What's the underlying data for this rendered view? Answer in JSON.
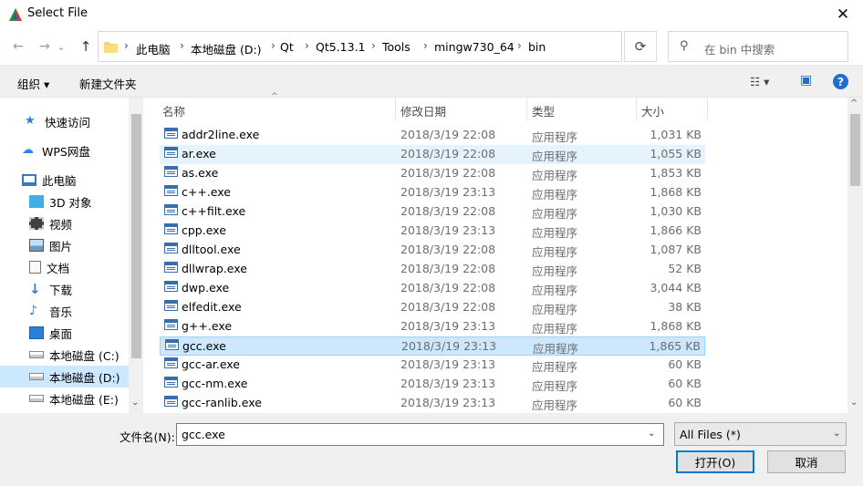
{
  "window": {
    "title": "Select File",
    "close": "✕"
  },
  "nav": {
    "back": "←",
    "forward": "→",
    "dropdown": "⌄",
    "up": "↑",
    "breadcrumb": [
      "此电脑",
      "本地磁盘 (D:)",
      "Qt",
      "Qt5.13.1",
      "Tools",
      "mingw730_64",
      "bin"
    ],
    "separator": "›",
    "refresh": "⟳",
    "search_placeholder": "在 bin 中搜索"
  },
  "toolbar": {
    "organize": "组织 ▾",
    "new_folder": "新建文件夹",
    "view_icon": "☷ ▾",
    "preview_icon": "▣",
    "help": "?"
  },
  "sidebar": {
    "items": [
      {
        "label": "快速访问",
        "icon": "star-icon"
      },
      {
        "label": "WPS网盘",
        "icon": "cloud-icon"
      },
      {
        "label": "此电脑",
        "icon": "computer-icon"
      },
      {
        "label": "3D 对象",
        "icon": "cube-icon"
      },
      {
        "label": "视频",
        "icon": "video-icon"
      },
      {
        "label": "图片",
        "icon": "picture-icon"
      },
      {
        "label": "文档",
        "icon": "document-icon"
      },
      {
        "label": "下载",
        "icon": "download-icon"
      },
      {
        "label": "音乐",
        "icon": "music-icon"
      },
      {
        "label": "桌面",
        "icon": "desktop-icon"
      },
      {
        "label": "本地磁盘 (C:)",
        "icon": "drive-icon"
      },
      {
        "label": "本地磁盘 (D:)",
        "icon": "drive-icon"
      },
      {
        "label": "本地磁盘 (E:)",
        "icon": "drive-icon"
      }
    ],
    "selected": "本地磁盘 (D:)"
  },
  "columns": {
    "name": "名称",
    "date": "修改日期",
    "type": "类型",
    "size": "大小"
  },
  "files": [
    {
      "name": "addr2line.exe",
      "date": "2018/3/19 22:08",
      "type": "应用程序",
      "size": "1,031 KB"
    },
    {
      "name": "ar.exe",
      "date": "2018/3/19 22:08",
      "type": "应用程序",
      "size": "1,055 KB"
    },
    {
      "name": "as.exe",
      "date": "2018/3/19 22:08",
      "type": "应用程序",
      "size": "1,853 KB"
    },
    {
      "name": "c++.exe",
      "date": "2018/3/19 23:13",
      "type": "应用程序",
      "size": "1,868 KB"
    },
    {
      "name": "c++filt.exe",
      "date": "2018/3/19 22:08",
      "type": "应用程序",
      "size": "1,030 KB"
    },
    {
      "name": "cpp.exe",
      "date": "2018/3/19 23:13",
      "type": "应用程序",
      "size": "1,866 KB"
    },
    {
      "name": "dlltool.exe",
      "date": "2018/3/19 22:08",
      "type": "应用程序",
      "size": "1,087 KB"
    },
    {
      "name": "dllwrap.exe",
      "date": "2018/3/19 22:08",
      "type": "应用程序",
      "size": "52 KB"
    },
    {
      "name": "dwp.exe",
      "date": "2018/3/19 22:08",
      "type": "应用程序",
      "size": "3,044 KB"
    },
    {
      "name": "elfedit.exe",
      "date": "2018/3/19 22:08",
      "type": "应用程序",
      "size": "38 KB"
    },
    {
      "name": "g++.exe",
      "date": "2018/3/19 23:13",
      "type": "应用程序",
      "size": "1,868 KB"
    },
    {
      "name": "gcc.exe",
      "date": "2018/3/19 23:13",
      "type": "应用程序",
      "size": "1,865 KB"
    },
    {
      "name": "gcc-ar.exe",
      "date": "2018/3/19 23:13",
      "type": "应用程序",
      "size": "60 KB"
    },
    {
      "name": "gcc-nm.exe",
      "date": "2018/3/19 23:13",
      "type": "应用程序",
      "size": "60 KB"
    },
    {
      "name": "gcc-ranlib.exe",
      "date": "2018/3/19 23:13",
      "type": "应用程序",
      "size": "60 KB"
    }
  ],
  "selected_file": "gcc.exe",
  "hovered_file": "ar.exe",
  "bottom": {
    "filename_label": "文件名(N):",
    "filename_value": "gcc.exe",
    "filter": "All Files  (*)",
    "open": "打开(O)",
    "cancel": "取消"
  },
  "colors": {
    "accent": "#0078d7",
    "selection": "#cce8ff",
    "hover": "#e5f3ff"
  }
}
